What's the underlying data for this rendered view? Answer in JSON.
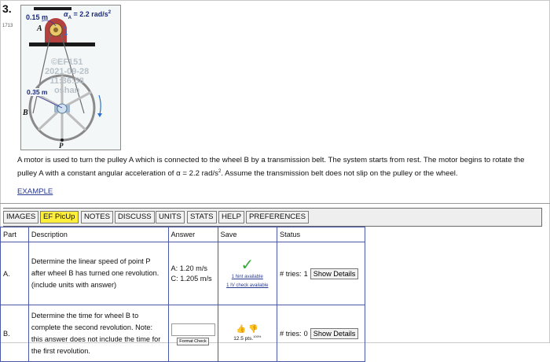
{
  "question": {
    "number": "3.",
    "id": "1713"
  },
  "figure": {
    "label_r_a": "0.15 m",
    "label_alpha": "α",
    "label_alpha_sub": "A",
    "label_alpha_value": " = 2.2 rad/s",
    "label_alpha_exp": "2",
    "label_a": "A",
    "label_r_b": "0.35 m",
    "label_b": "B",
    "label_p": "P",
    "watermark_line1": "©EF151",
    "watermark_line2": "2021-09-28",
    "watermark_line3": "11:36:58",
    "watermark_line4": "oshan"
  },
  "problem": {
    "text_pre": "A motor is used to turn the pulley A which is connected to the wheel B by a transmission belt. The system starts from rest. The motor begins to rotate the pulley A with a constant angular acceleration of α = 2.2 rad/s",
    "text_exp": "2",
    "text_post": ". Assume the transmission belt does not slip on the pulley or the wheel.",
    "example_link": "EXAMPLE"
  },
  "toolbar": {
    "tabs": [
      "IMAGES",
      "EF PicUp",
      "NOTES",
      "DISCUSS",
      "UNITS",
      "STATS",
      "HELP",
      "PREFERENCES"
    ],
    "active": "EF PicUp"
  },
  "table": {
    "headers": [
      "Part",
      "Description",
      "Answer",
      "Save",
      "Status"
    ],
    "rows": [
      {
        "part": "A.",
        "description": "Determine the linear speed of point P after wheel B has turned one revolution. (include units with answer)",
        "answer_line1": "A: 1.20 m/s",
        "answer_line2": "C: 1.205 m/s",
        "hint_link": "1 hint available",
        "check_link": "1 IV check available",
        "status_tries_label": "# tries: ",
        "status_tries_value": "1",
        "show_details": "Show Details"
      },
      {
        "part": "B.",
        "description": "Determine the time for wheel B to complete the second revolution. Note: this answer does not include the time for the first revolution.",
        "answer_value": "",
        "format_check": "Format Check",
        "points": "12.5 pts.",
        "points_pct": "100%",
        "status_tries_label": "# tries: ",
        "status_tries_value": "0",
        "show_details": "Show Details"
      }
    ]
  },
  "colors": {
    "accent_blue": "#2a4aa8",
    "active_tab": "#ffef3a",
    "pulley_red": "#b23a3a",
    "check_green": "#3aa83a"
  }
}
